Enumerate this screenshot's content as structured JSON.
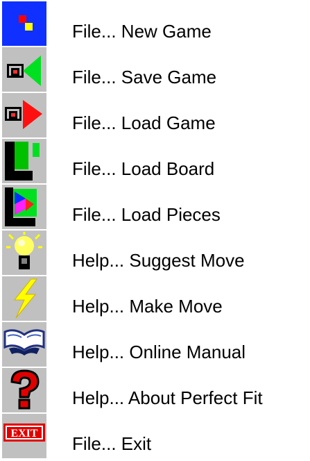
{
  "toolbar_legend": {
    "items": [
      {
        "icon": "new-game-icon",
        "label": "File... New Game"
      },
      {
        "icon": "save-game-icon",
        "label": "File... Save Game"
      },
      {
        "icon": "load-game-icon",
        "label": "File... Load Game"
      },
      {
        "icon": "load-board-icon",
        "label": "File... Load Board"
      },
      {
        "icon": "load-pieces-icon",
        "label": "File... Load Pieces"
      },
      {
        "icon": "lightbulb-icon",
        "label": "Help... Suggest Move"
      },
      {
        "icon": "lightning-icon",
        "label": "Help... Make Move"
      },
      {
        "icon": "book-icon",
        "label": "Help... Online Manual"
      },
      {
        "icon": "question-mark-icon",
        "label": "Help... About Perfect Fit"
      },
      {
        "icon": "exit-icon",
        "label": "File... Exit"
      }
    ],
    "exit_icon_text": "EXIT"
  }
}
